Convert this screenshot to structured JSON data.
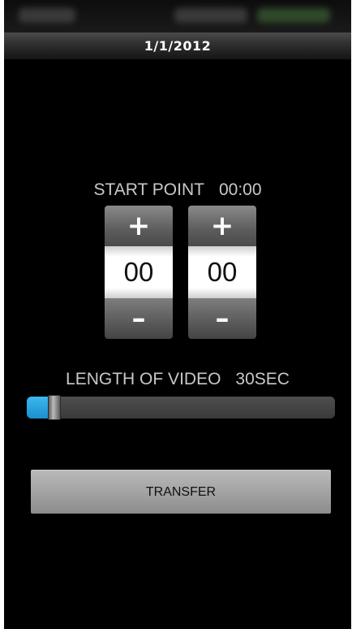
{
  "header": {
    "title": "1/1/2012"
  },
  "start_point": {
    "label": "START POINT",
    "value": "00:00",
    "minutes": {
      "increment_symbol": "+",
      "value": "00",
      "decrement_symbol": "–"
    },
    "seconds": {
      "increment_symbol": "+",
      "value": "00",
      "decrement_symbol": "–"
    }
  },
  "length": {
    "label": "LENGTH OF VIDEO",
    "value": "30SEC",
    "slider_fraction": 0.09
  },
  "actions": {
    "transfer_label": "TRANSFER"
  },
  "colors": {
    "accent": "#2aa6e3",
    "background": "#000000"
  }
}
